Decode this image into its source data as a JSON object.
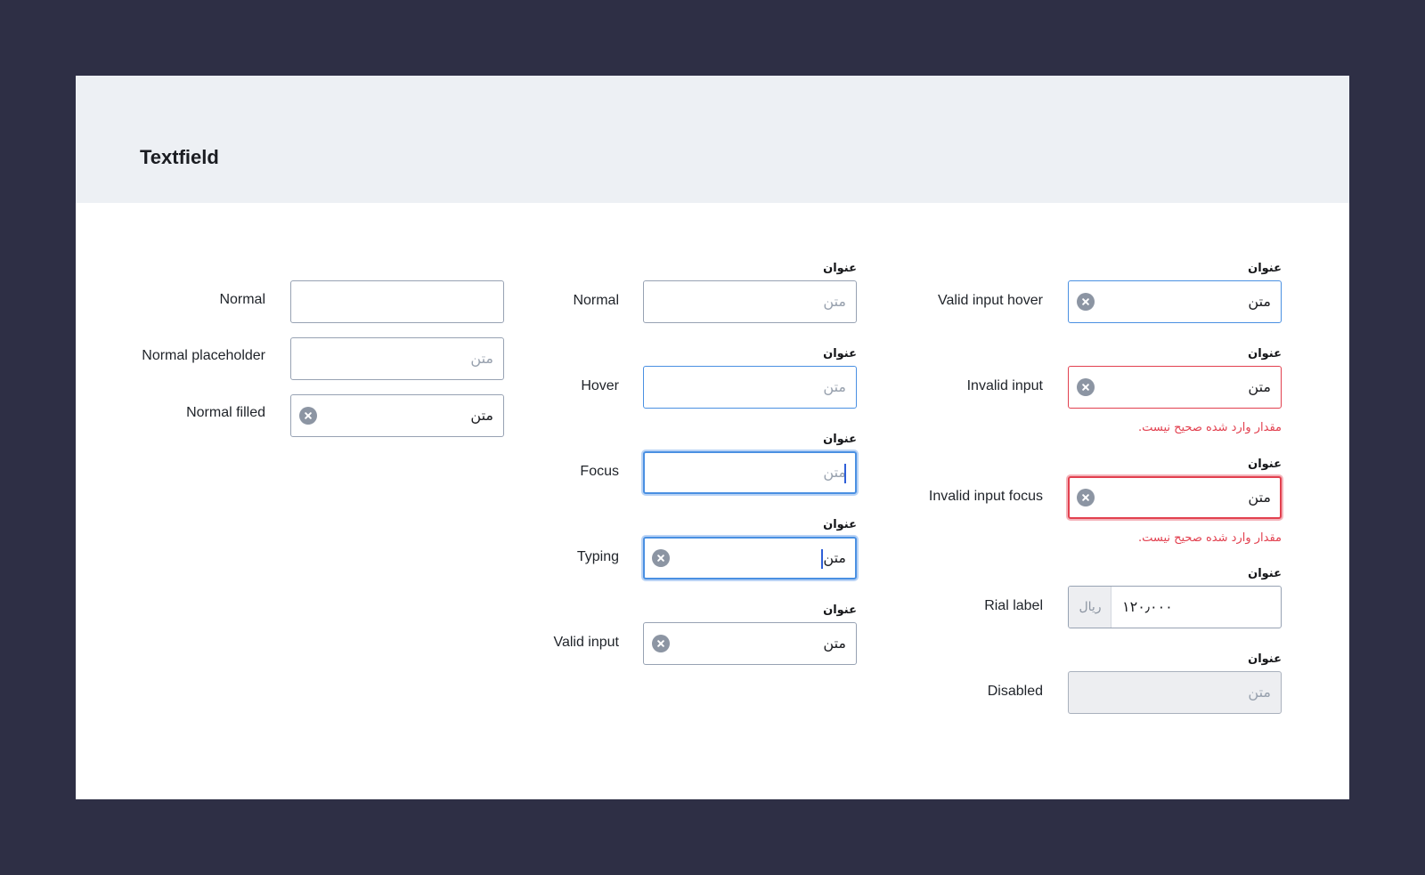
{
  "page": {
    "title": "Textfield"
  },
  "field_title": "عنوان",
  "column1": {
    "normal": {
      "row_label": "Normal"
    },
    "normal_placeholder": {
      "row_label": "Normal placeholder",
      "placeholder": "متن"
    },
    "normal_filled": {
      "row_label": "Normal filled",
      "value": "متن"
    }
  },
  "column2": {
    "normal": {
      "row_label": "Normal",
      "placeholder": "متن"
    },
    "hover": {
      "row_label": "Hover",
      "placeholder": "متن"
    },
    "focus": {
      "row_label": "Focus",
      "placeholder": "متن"
    },
    "typing": {
      "row_label": "Typing",
      "value": "متن"
    },
    "valid_input": {
      "row_label": "Valid input",
      "value": "متن"
    }
  },
  "column3": {
    "valid_input_hover": {
      "row_label": "Valid input hover",
      "value": "متن"
    },
    "invalid_input": {
      "row_label": "Invalid input",
      "value": "متن",
      "error": "مقدار وارد شده صحیح نیست."
    },
    "invalid_input_focus": {
      "row_label": "Invalid input focus",
      "value": "متن",
      "error": "مقدار وارد شده صحیح نیست."
    },
    "rial_label": {
      "row_label": "Rial label",
      "value": "۱۲۰٫۰۰۰",
      "currency": "ریال"
    },
    "disabled": {
      "row_label": "Disabled",
      "placeholder": "متن"
    }
  },
  "colors": {
    "background": "#2e2f45",
    "header": "#edf0f4",
    "border": "#97a2b3",
    "focus_blue": "#4a90e2",
    "error_red": "#e2404f",
    "clear_icon": "#8c95a3",
    "disabled_bg": "#edeef1"
  },
  "icons": {
    "clear": "clear-icon",
    "caret": "text-caret"
  }
}
